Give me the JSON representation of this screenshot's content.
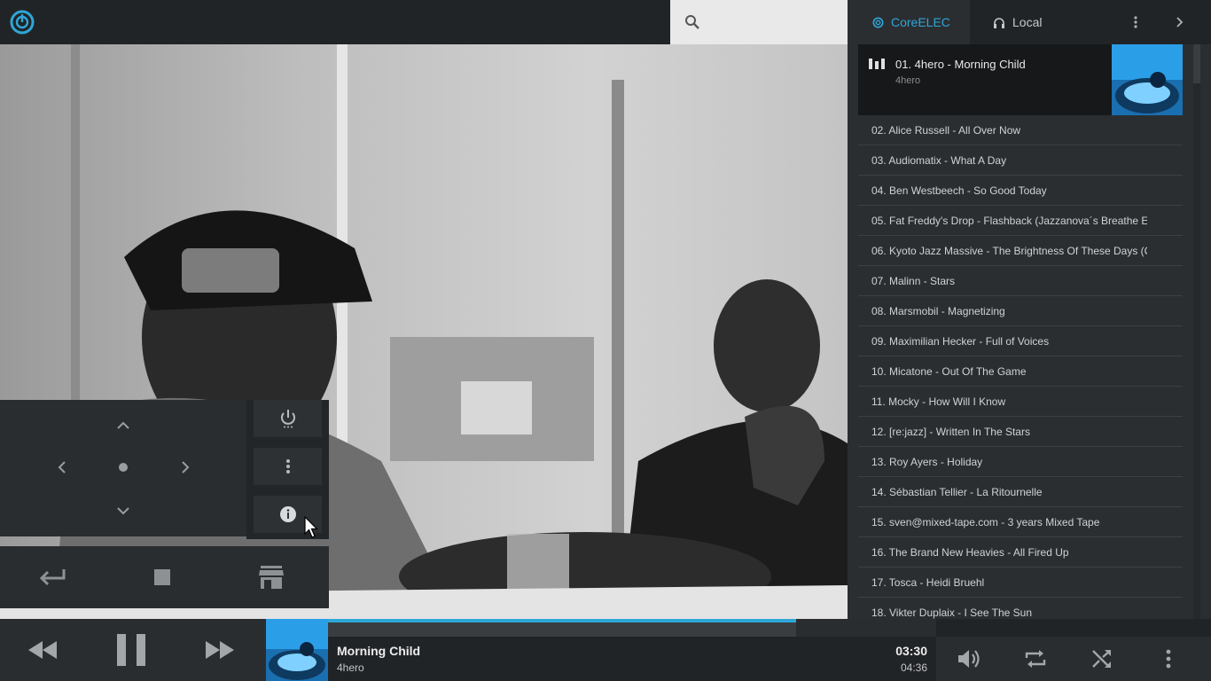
{
  "app": {
    "logo_icon": "power-logo-icon",
    "accent": "#2ea6d8"
  },
  "search": {
    "icon": "search-icon"
  },
  "tabs": [
    {
      "label": "CoreELEC",
      "icon": "kodi-icon",
      "active": true
    },
    {
      "label": "Local",
      "icon": "headphones-icon",
      "active": false
    }
  ],
  "now_playing": {
    "title": "01. 4hero - Morning Child",
    "artist": "4hero"
  },
  "playlist": [
    "02. Alice Russell - All Over Now",
    "03. Audiomatix - What A Day",
    "04. Ben Westbeech - So Good Today",
    "05. Fat Freddy's Drop - Flashback (Jazzanova´s Breathe E",
    "06. Kyoto Jazz Massive - The Brightness Of These Days (C",
    "07. Malinn - Stars",
    "08. Marsmobil - Magnetizing",
    "09. Maximilian Hecker - Full of Voices",
    "10. Micatone - Out Of The Game",
    "11. Mocky - How Will I Know",
    "12. [re:jazz] - Written In The Stars",
    "13. Roy Ayers - Holiday",
    "14. Sébastian Tellier - La Ritournelle",
    "15. sven@mixed-tape.com - 3 years Mixed Tape",
    "16. The Brand New Heavies - All Fired Up",
    "17. Tosca - Heidi Bruehl",
    "18. Vikter Duplaix - I See The Sun"
  ],
  "player": {
    "title": "Morning Child",
    "artist": "4hero",
    "elapsed": "03:30",
    "duration": "04:36",
    "progress_fraction": 0.77,
    "buffered_fraction": 0.77
  }
}
